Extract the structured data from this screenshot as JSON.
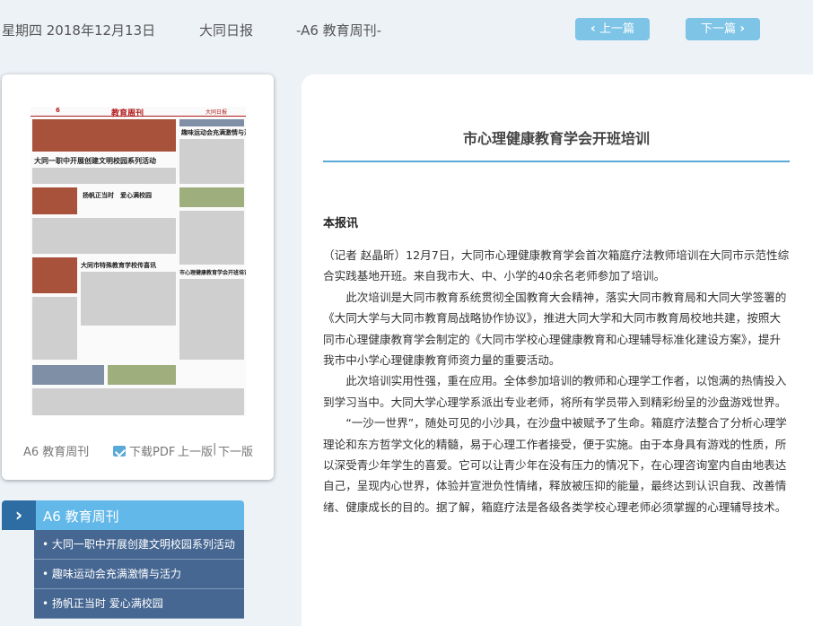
{
  "header": {
    "date": "星期四 2018年12月13日",
    "paper": "大同日报",
    "section": "-A6 教育周刊-",
    "prev_label": "上一篇",
    "next_label": "下一篇",
    "prev_icon": "chevron-left-icon",
    "next_icon": "chevron-right-icon"
  },
  "page_card": {
    "section_label": "A6 教育周刊",
    "download_pdf": "下载PDF",
    "prev_page": "上一版",
    "separator": "|",
    "next_page": "下一版",
    "thumbnail": {
      "masthead": "教育周刊",
      "brand": "大同日报",
      "page_no": "6",
      "headlines": [
        "大同一职中开展创建文明校园系列活动",
        "扬帆正当时　爱心满校园",
        "大同市特殊教育学校传喜讯",
        "趣味运动会充满激情与活力",
        "市心理健康教育学会开班培训"
      ]
    }
  },
  "section_list": {
    "title": "A6 教育周刊",
    "arrow_icon": "chevron-right-icon",
    "items": [
      "• 大同一职中开展创建文明校园系列活动",
      "• 趣味运动会充满激情与活力",
      "• 扬帆正当时 爱心满校园"
    ]
  },
  "article": {
    "title": "市心理健康教育学会开班培训",
    "byline": "本报讯",
    "paragraphs": [
      "（记者 赵晶昕）12月7日，大同市心理健康教育学会首次箱庭疗法教师培训在大同市示范性综合实践基地开班。来自我市大、中、小学的40余名老师参加了培训。",
      "此次培训是大同市教育系统贯彻全国教育大会精神，落实大同市教育局和大同大学签署的《大同大学与大同市教育局战略协作协议》，推进大同大学和大同市教育局校地共建，按照大同市心理健康教育学会制定的《大同市学校心理健康教育和心理辅导标准化建设方案》，提升我市中小学心理健康教育师资力量的重要活动。",
      "此次培训实用性强，重在应用。全体参加培训的教师和心理学工作者，以饱满的热情投入到学习当中。大同大学心理学系派出专业老师，将所有学员带入到精彩纷呈的沙盘游戏世界。",
      "“一沙一世界”，随处可见的小沙具，在沙盘中被赋予了生命。箱庭疗法整合了分析心理学理论和东方哲学文化的精髓，易于心理工作者接受，便于实施。由于本身具有游戏的性质，所以深受青少年学生的喜爱。它可以让青少年在没有压力的情况下，在心理咨询室内自由地表达自己，呈现内心世界，体验并宣泄负性情绪，释放被压抑的能量，最终达到认识自我、改善情绪、健康成长的目的。据了解，箱庭疗法是各级各类学校心理老师必须掌握的心理辅导技术。"
    ]
  },
  "colors": {
    "background": "#edf2f7",
    "button": "#7ec4e6",
    "accent": "#5aa9d6",
    "list_bg": "#466792",
    "section_head": "#62b8e8",
    "arrow_box": "#2e6da4"
  }
}
